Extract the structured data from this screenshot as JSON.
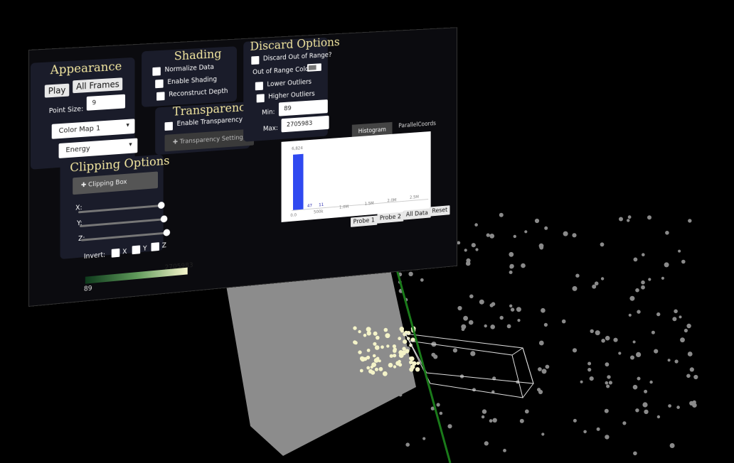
{
  "appearance": {
    "title": "Appearance",
    "play_label": "Play",
    "all_frames_label": "All Frames",
    "point_size_label": "Point Size:",
    "point_size_value": "9",
    "colormap_value": "Color Map 1",
    "variable_value": "Energy"
  },
  "shading": {
    "title": "Shading",
    "normalize_label": "Normalize Data",
    "enable_shading_label": "Enable Shading",
    "reconstruct_label": "Reconstruct Depth"
  },
  "transparency": {
    "title": "Transparency",
    "enable_label": "Enable Transparency",
    "settings_label": "Transparency Settings"
  },
  "discard": {
    "title": "Discard Options",
    "out_of_range_label": "Discard Out of Range?",
    "out_of_range_color_label": "Out of Range Color:",
    "lower_label": "Lower Outliers",
    "higher_label": "Higher Outliers",
    "min_label": "Min:",
    "min_value": "89",
    "max_label": "Max:",
    "max_value": "2705983"
  },
  "clipping": {
    "title": "Clipping Options",
    "box_label": "Clipping Box",
    "x_label": "X:",
    "y_label": "Y:",
    "z_label": "Z:",
    "invert_label": "Invert:",
    "invert_x": "X",
    "invert_y": "Y",
    "invert_z": "Z"
  },
  "colorbar": {
    "min": "89",
    "max": "2705983"
  },
  "tabs": {
    "histogram": "Histogram",
    "parallel": "ParallelCoords"
  },
  "histogram": {
    "top_label": "6,824",
    "x_ticks": [
      "0.0",
      "500k",
      "1.0M",
      "1.5M",
      "2.0M",
      "2.5M"
    ],
    "bar_counts": [
      "47",
      "11"
    ]
  },
  "probe": {
    "probe1": "Probe 1",
    "probe2": "Probe 2",
    "all_data": "All Data",
    "reset": "Reset"
  },
  "chart_data": {
    "type": "bar",
    "categories": [
      "0.0",
      "500k",
      "1.0M",
      "1.5M",
      "2.0M",
      "2.5M"
    ],
    "values": [
      6824,
      47,
      11,
      0,
      0,
      0
    ],
    "title": "",
    "xlabel": "",
    "ylabel": ""
  },
  "colors": {
    "accent_title": "#f3e7a0",
    "histogram_bar": "#2f49f0",
    "probe_line": "#1a7a1a",
    "points": "#8a8a8a",
    "points_highlight": "#f4f3c8"
  }
}
